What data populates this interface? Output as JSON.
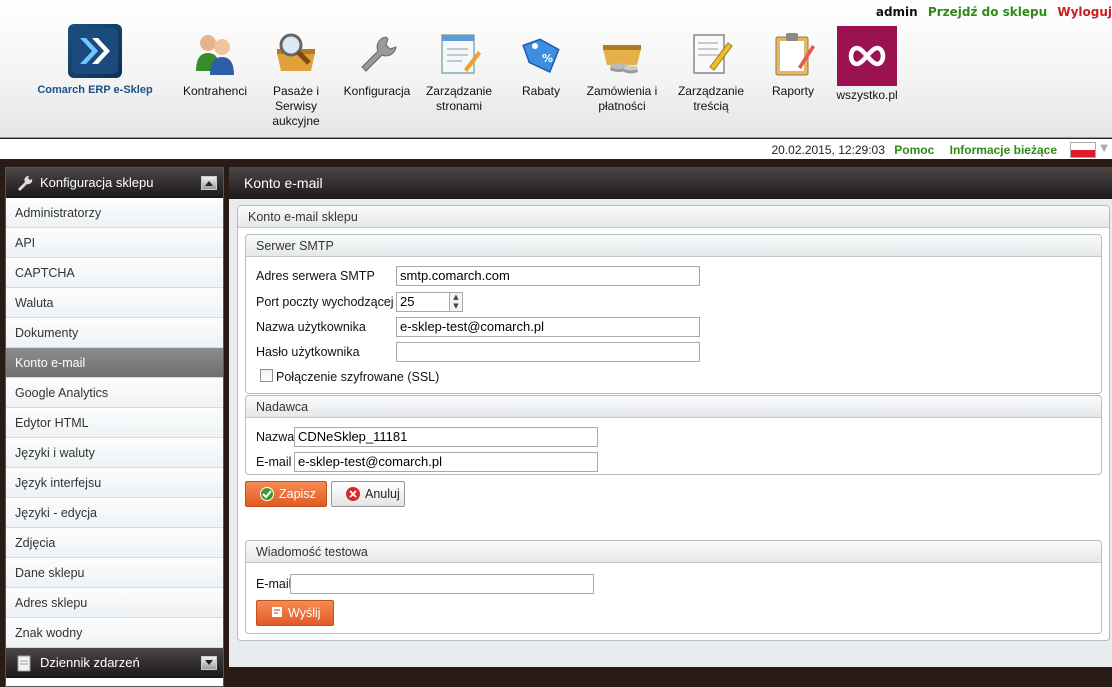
{
  "header": {
    "user": "admin",
    "shop_link": "Przejdź do sklepu",
    "logout": "Wyloguj",
    "logo_label": "Comarch ERP e-Sklep",
    "nav": [
      {
        "label": "Kontrahenci",
        "icon": "users-icon"
      },
      {
        "label": "Pasaże i Serwisy aukcyjne",
        "icon": "basket-magnifier-icon"
      },
      {
        "label": "Konfiguracja",
        "icon": "wrench-icon"
      },
      {
        "label": "Zarządzanie stronami",
        "icon": "page-edit-icon"
      },
      {
        "label": "Rabaty",
        "icon": "discount-tag-icon"
      },
      {
        "label": "Zamówienia i płatności",
        "icon": "basket-coins-icon"
      },
      {
        "label": "Zarządzanie treścią",
        "icon": "document-pencil-icon"
      },
      {
        "label": "Raporty",
        "icon": "clipboard-icon"
      },
      {
        "label": "wszystko.pl",
        "icon": "infinity-icon"
      }
    ]
  },
  "status": {
    "datetime": "20.02.2015, 12:29:03",
    "help": "Pomoc",
    "info": "Informacje bieżące"
  },
  "sidebar": {
    "section_title": "Konfiguracja sklepu",
    "items": [
      "Administratorzy",
      "API",
      "CAPTCHA",
      "Waluta",
      "Dokumenty",
      "Konto e-mail",
      "Google Analytics",
      "Edytor HTML",
      "Języki i waluty",
      "Język interfejsu",
      "Języki - edycja",
      "Zdjęcia",
      "Dane sklepu",
      "Adres sklepu",
      "Znak wodny"
    ],
    "active_index": 5,
    "section2_title": "Dziennik zdarzeń"
  },
  "main": {
    "title": "Konto e-mail",
    "account_panel_title": "Konto e-mail sklepu",
    "smtp": {
      "title": "Serwer SMTP",
      "server_label": "Adres serwera SMTP",
      "server_value": "smtp.comarch.com",
      "port_label": "Port poczty wychodzącej",
      "port_value": "25",
      "user_label": "Nazwa użytkownika",
      "user_value": "e-sklep-test@comarch.pl",
      "password_label": "Hasło użytkownika",
      "password_value": "",
      "ssl_label": "Połączenie szyfrowane (SSL)"
    },
    "sender": {
      "title": "Nadawca",
      "name_label": "Nazwa",
      "name_value": "CDNeSklep_11181",
      "email_label": "E-mail",
      "email_value": "e-sklep-test@comarch.pl"
    },
    "save_button": "Zapisz",
    "cancel_button": "Anuluj",
    "test": {
      "title": "Wiadomość testowa",
      "email_label": "E-mail",
      "email_value": "",
      "send_button": "Wyślij"
    }
  },
  "colors": {
    "green_link": "#2f8a15",
    "red_link": "#cc1c1c",
    "orange_button": "#e25a24",
    "dark_bar": "#1d1a19"
  }
}
